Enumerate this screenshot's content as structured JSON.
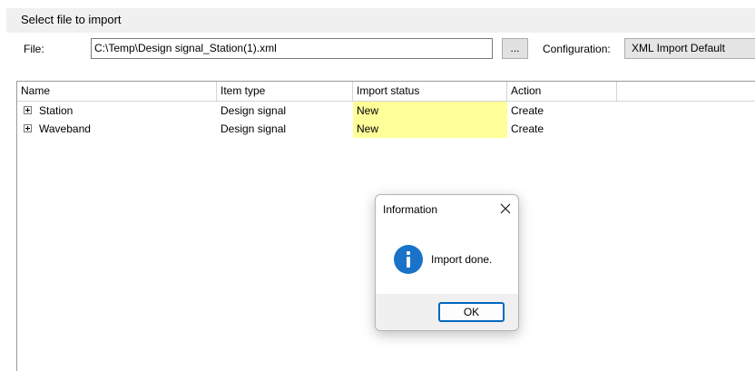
{
  "section": {
    "title": "Select file to import"
  },
  "file": {
    "label": "File:",
    "value": "C:\\Temp\\Design signal_Station(1).xml"
  },
  "browse": {
    "label": "..."
  },
  "configuration": {
    "label": "Configuration:",
    "value": "XML Import Default"
  },
  "grid": {
    "columns": [
      "Name",
      "Item type",
      "Import status",
      "Action"
    ],
    "rows": [
      {
        "name": "Station",
        "item_type": "Design signal",
        "import_status": "New",
        "action": "Create"
      },
      {
        "name": "Waveband",
        "item_type": "Design signal",
        "import_status": "New",
        "action": "Create"
      }
    ],
    "status_color": "#ffff99"
  },
  "dialog": {
    "title": "Information",
    "message": "Import done.",
    "ok_label": "OK",
    "icon": "information-icon",
    "icon_color": "#1a73c9"
  }
}
